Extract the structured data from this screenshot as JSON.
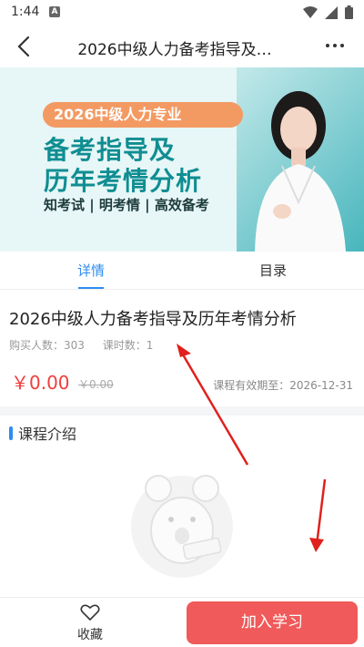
{
  "status_bar": {
    "time": "1:44",
    "notification_glyph": "A",
    "icons": [
      "wifi-icon",
      "signal-icon",
      "battery-icon"
    ]
  },
  "nav": {
    "title": "2026中级人力备考指导及…",
    "back_icon": "back-icon",
    "more_icon": "more-icon"
  },
  "banner": {
    "pill_text": "2026中级人力专业",
    "headline_line1": "备考指导及",
    "headline_line2": "历年考情分析",
    "tagline": "知考试 | 明考情 | 高效备考"
  },
  "tabs": [
    {
      "label": "详情",
      "active": true
    },
    {
      "label": "目录",
      "active": false
    }
  ],
  "course": {
    "title": "2026中级人力备考指导及历年考情分析",
    "buyers_label": "购买人数：303",
    "lessons_label": "课时数：1",
    "price": "￥0.00",
    "original_price": "￥0.00",
    "valid_until": "课程有效期至：2026-12-31"
  },
  "section": {
    "title": "课程介绍"
  },
  "bottom_bar": {
    "favorite_label": "收藏",
    "join_label": "加入学习"
  },
  "colors": {
    "accent_blue": "#2d8cf0",
    "price_red": "#f03e3e",
    "join_button": "#f05a5a",
    "banner_teal": "#0f8e92",
    "banner_orange": "#f39a63",
    "annotation_arrow": "#e0201c"
  }
}
